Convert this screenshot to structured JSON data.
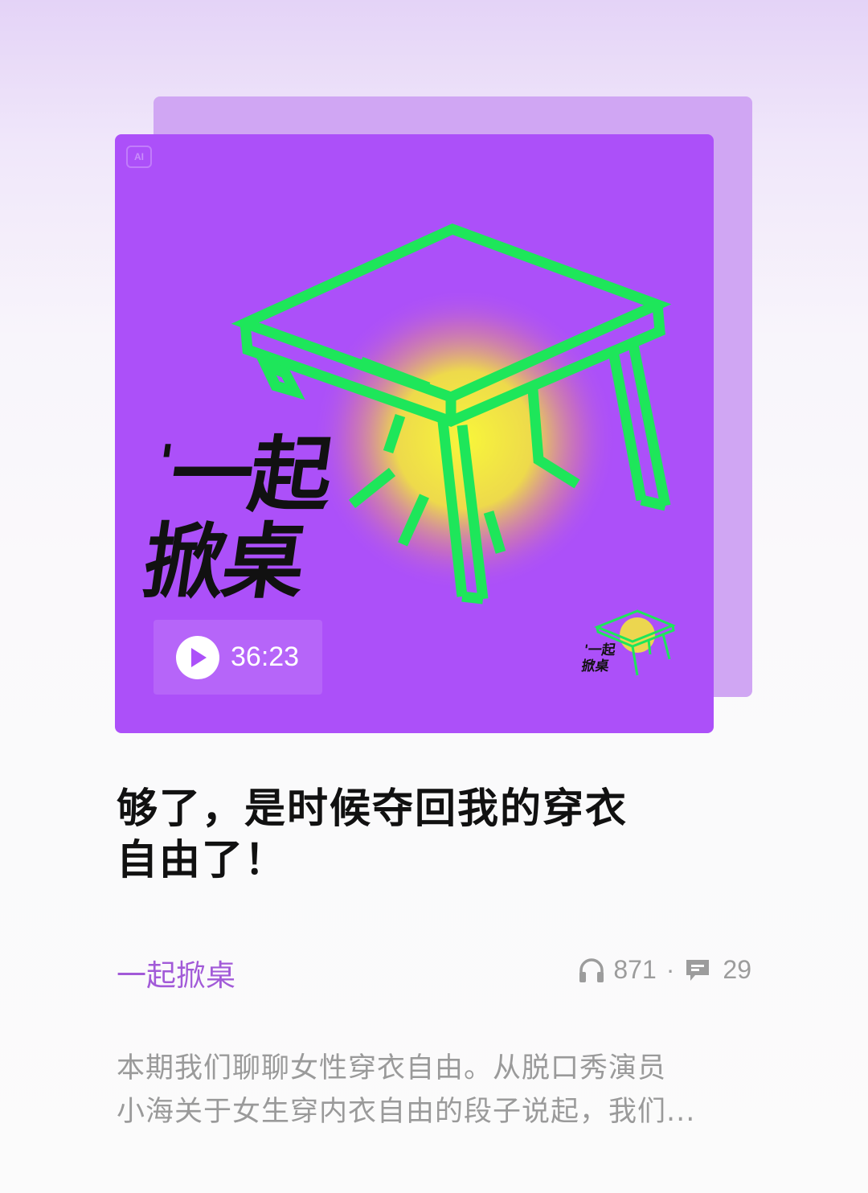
{
  "cover": {
    "ai_badge": "AI",
    "title_mark": "'",
    "title_line1": "一起",
    "title_line2": "掀桌",
    "duration": "36:23",
    "mini_logo_line1": "'一起",
    "mini_logo_line2": "掀桌",
    "colors": {
      "background": "#ac50f9",
      "table_stroke": "#1ee65a",
      "glow": "#f5f03a"
    }
  },
  "episode": {
    "title_line1": "够了，是时候夺回我的穿衣",
    "title_line2": "自由了！",
    "podcast_name": "一起掀桌",
    "listen_count": "871",
    "stats_separator": "·",
    "comment_count": "29",
    "description_line1": "本期我们聊聊女性穿衣自由。从脱口秀演员",
    "description_line2": "小海关于女生穿内衣自由的段子说起，我们..."
  },
  "icons": {
    "play": "play-icon",
    "listen": "headphones-icon",
    "comment": "comment-icon"
  }
}
